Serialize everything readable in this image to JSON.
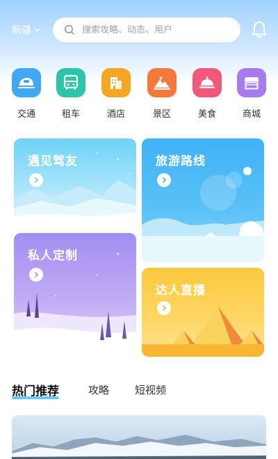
{
  "header": {
    "region": "新疆",
    "search_placeholder": "搜索攻略、动态、用户"
  },
  "categories": [
    {
      "label": "交通",
      "icon": "train-icon",
      "color": "#42a8f5"
    },
    {
      "label": "租车",
      "icon": "bus-icon",
      "color": "#2cc5a9"
    },
    {
      "label": "酒店",
      "icon": "hotel-icon",
      "color": "#f5a623"
    },
    {
      "label": "景区",
      "icon": "mountain-icon",
      "color": "#f5793d"
    },
    {
      "label": "美食",
      "icon": "cloche-icon",
      "color": "#f2587c"
    },
    {
      "label": "商城",
      "icon": "shop-icon",
      "color": "#a77bf0"
    }
  ],
  "cards": {
    "driver_friends": "遇见驾友",
    "travel_routes": "旅游路线",
    "custom_tour": "私人定制",
    "live_stream": "达人直播"
  },
  "tabs": [
    {
      "label": "热门推荐",
      "active": true
    },
    {
      "label": "攻略",
      "active": false
    },
    {
      "label": "短视频",
      "active": false
    }
  ]
}
